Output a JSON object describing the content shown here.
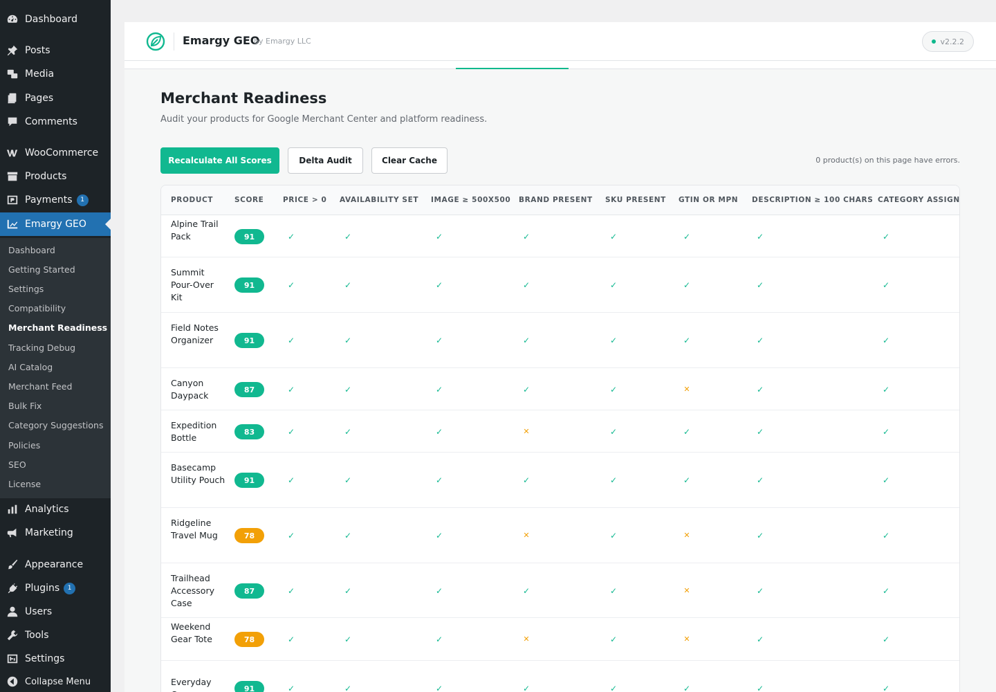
{
  "sidebar": {
    "items": [
      {
        "label": "Dashboard",
        "icon": "dashboard-icon"
      },
      {
        "label": "Posts",
        "icon": "pushpin-icon"
      },
      {
        "label": "Media",
        "icon": "media-icon"
      },
      {
        "label": "Pages",
        "icon": "pages-icon"
      },
      {
        "label": "Comments",
        "icon": "comment-icon"
      },
      {
        "label": "WooCommerce",
        "icon": "woocommerce-icon"
      },
      {
        "label": "Products",
        "icon": "archive-icon"
      },
      {
        "label": "Payments",
        "icon": "payments-icon",
        "badge": "1"
      },
      {
        "label": "Emargy GEO",
        "icon": "chart-line-icon"
      },
      {
        "label": "Analytics",
        "icon": "bar-chart-icon"
      },
      {
        "label": "Marketing",
        "icon": "megaphone-icon"
      },
      {
        "label": "Appearance",
        "icon": "brush-icon"
      },
      {
        "label": "Plugins",
        "icon": "plugin-icon",
        "badge": "1"
      },
      {
        "label": "Users",
        "icon": "user-icon"
      },
      {
        "label": "Tools",
        "icon": "wrench-icon"
      },
      {
        "label": "Settings",
        "icon": "settings-icon"
      },
      {
        "label": "Collapse Menu",
        "icon": "collapse-icon"
      }
    ],
    "submenu": [
      "Dashboard",
      "Getting Started",
      "Settings",
      "Compatibility",
      "Merchant Readiness",
      "Tracking Debug",
      "AI Catalog",
      "Merchant Feed",
      "Bulk Fix",
      "Category Suggestions",
      "Policies",
      "SEO",
      "License"
    ],
    "submenu_active": "Merchant Readiness"
  },
  "header": {
    "brand_name": "Emargy GEO",
    "brand_by": "by Emargy LLC",
    "version": "v2.2.2",
    "accent_color": "#11b890"
  },
  "page": {
    "title": "Merchant Readiness",
    "subtitle": "Audit your products for Google Merchant Center and platform readiness.",
    "buttons": {
      "recalculate": "Recalculate All Scores",
      "delta": "Delta Audit",
      "clear": "Clear Cache"
    },
    "error_note": "0 product(s) on this page have errors."
  },
  "table": {
    "columns": [
      "PRODUCT",
      "SCORE",
      "PRICE > 0",
      "AVAILABILITY SET",
      "IMAGE ≥ 500X500",
      "BRAND PRESENT",
      "SKU PRESENT",
      "GTIN OR MPN",
      "DESCRIPTION ≥ 100 CHARS",
      "CATEGORY ASSIGNED"
    ],
    "rows": [
      {
        "name": "Alpine Trail Pack",
        "score": "91",
        "checks": [
          true,
          true,
          true,
          true,
          true,
          true,
          true,
          true
        ]
      },
      {
        "name": "Summit Pour-Over Kit",
        "score": "91",
        "checks": [
          true,
          true,
          true,
          true,
          true,
          true,
          true,
          true
        ]
      },
      {
        "name": "Field Notes Organizer",
        "score": "91",
        "checks": [
          true,
          true,
          true,
          true,
          true,
          true,
          true,
          true
        ]
      },
      {
        "name": "Canyon Daypack",
        "score": "87",
        "checks": [
          true,
          true,
          true,
          true,
          true,
          false,
          true,
          true
        ]
      },
      {
        "name": "Expedition Bottle",
        "score": "83",
        "checks": [
          true,
          true,
          true,
          false,
          true,
          true,
          true,
          true
        ]
      },
      {
        "name": "Basecamp Utility Pouch",
        "score": "91",
        "checks": [
          true,
          true,
          true,
          true,
          true,
          true,
          true,
          true
        ]
      },
      {
        "name": "Ridgeline Travel Mug",
        "score": "78",
        "checks": [
          true,
          true,
          true,
          false,
          true,
          false,
          true,
          true
        ]
      },
      {
        "name": "Trailhead Accessory Case",
        "score": "87",
        "checks": [
          true,
          true,
          true,
          true,
          true,
          false,
          true,
          true
        ]
      },
      {
        "name": "Weekend Gear Tote",
        "score": "78",
        "checks": [
          true,
          true,
          true,
          false,
          true,
          false,
          true,
          true
        ]
      },
      {
        "name": "Everyday Carry",
        "score": "91",
        "checks": [
          true,
          true,
          true,
          true,
          true,
          true,
          true,
          true
        ]
      }
    ]
  }
}
